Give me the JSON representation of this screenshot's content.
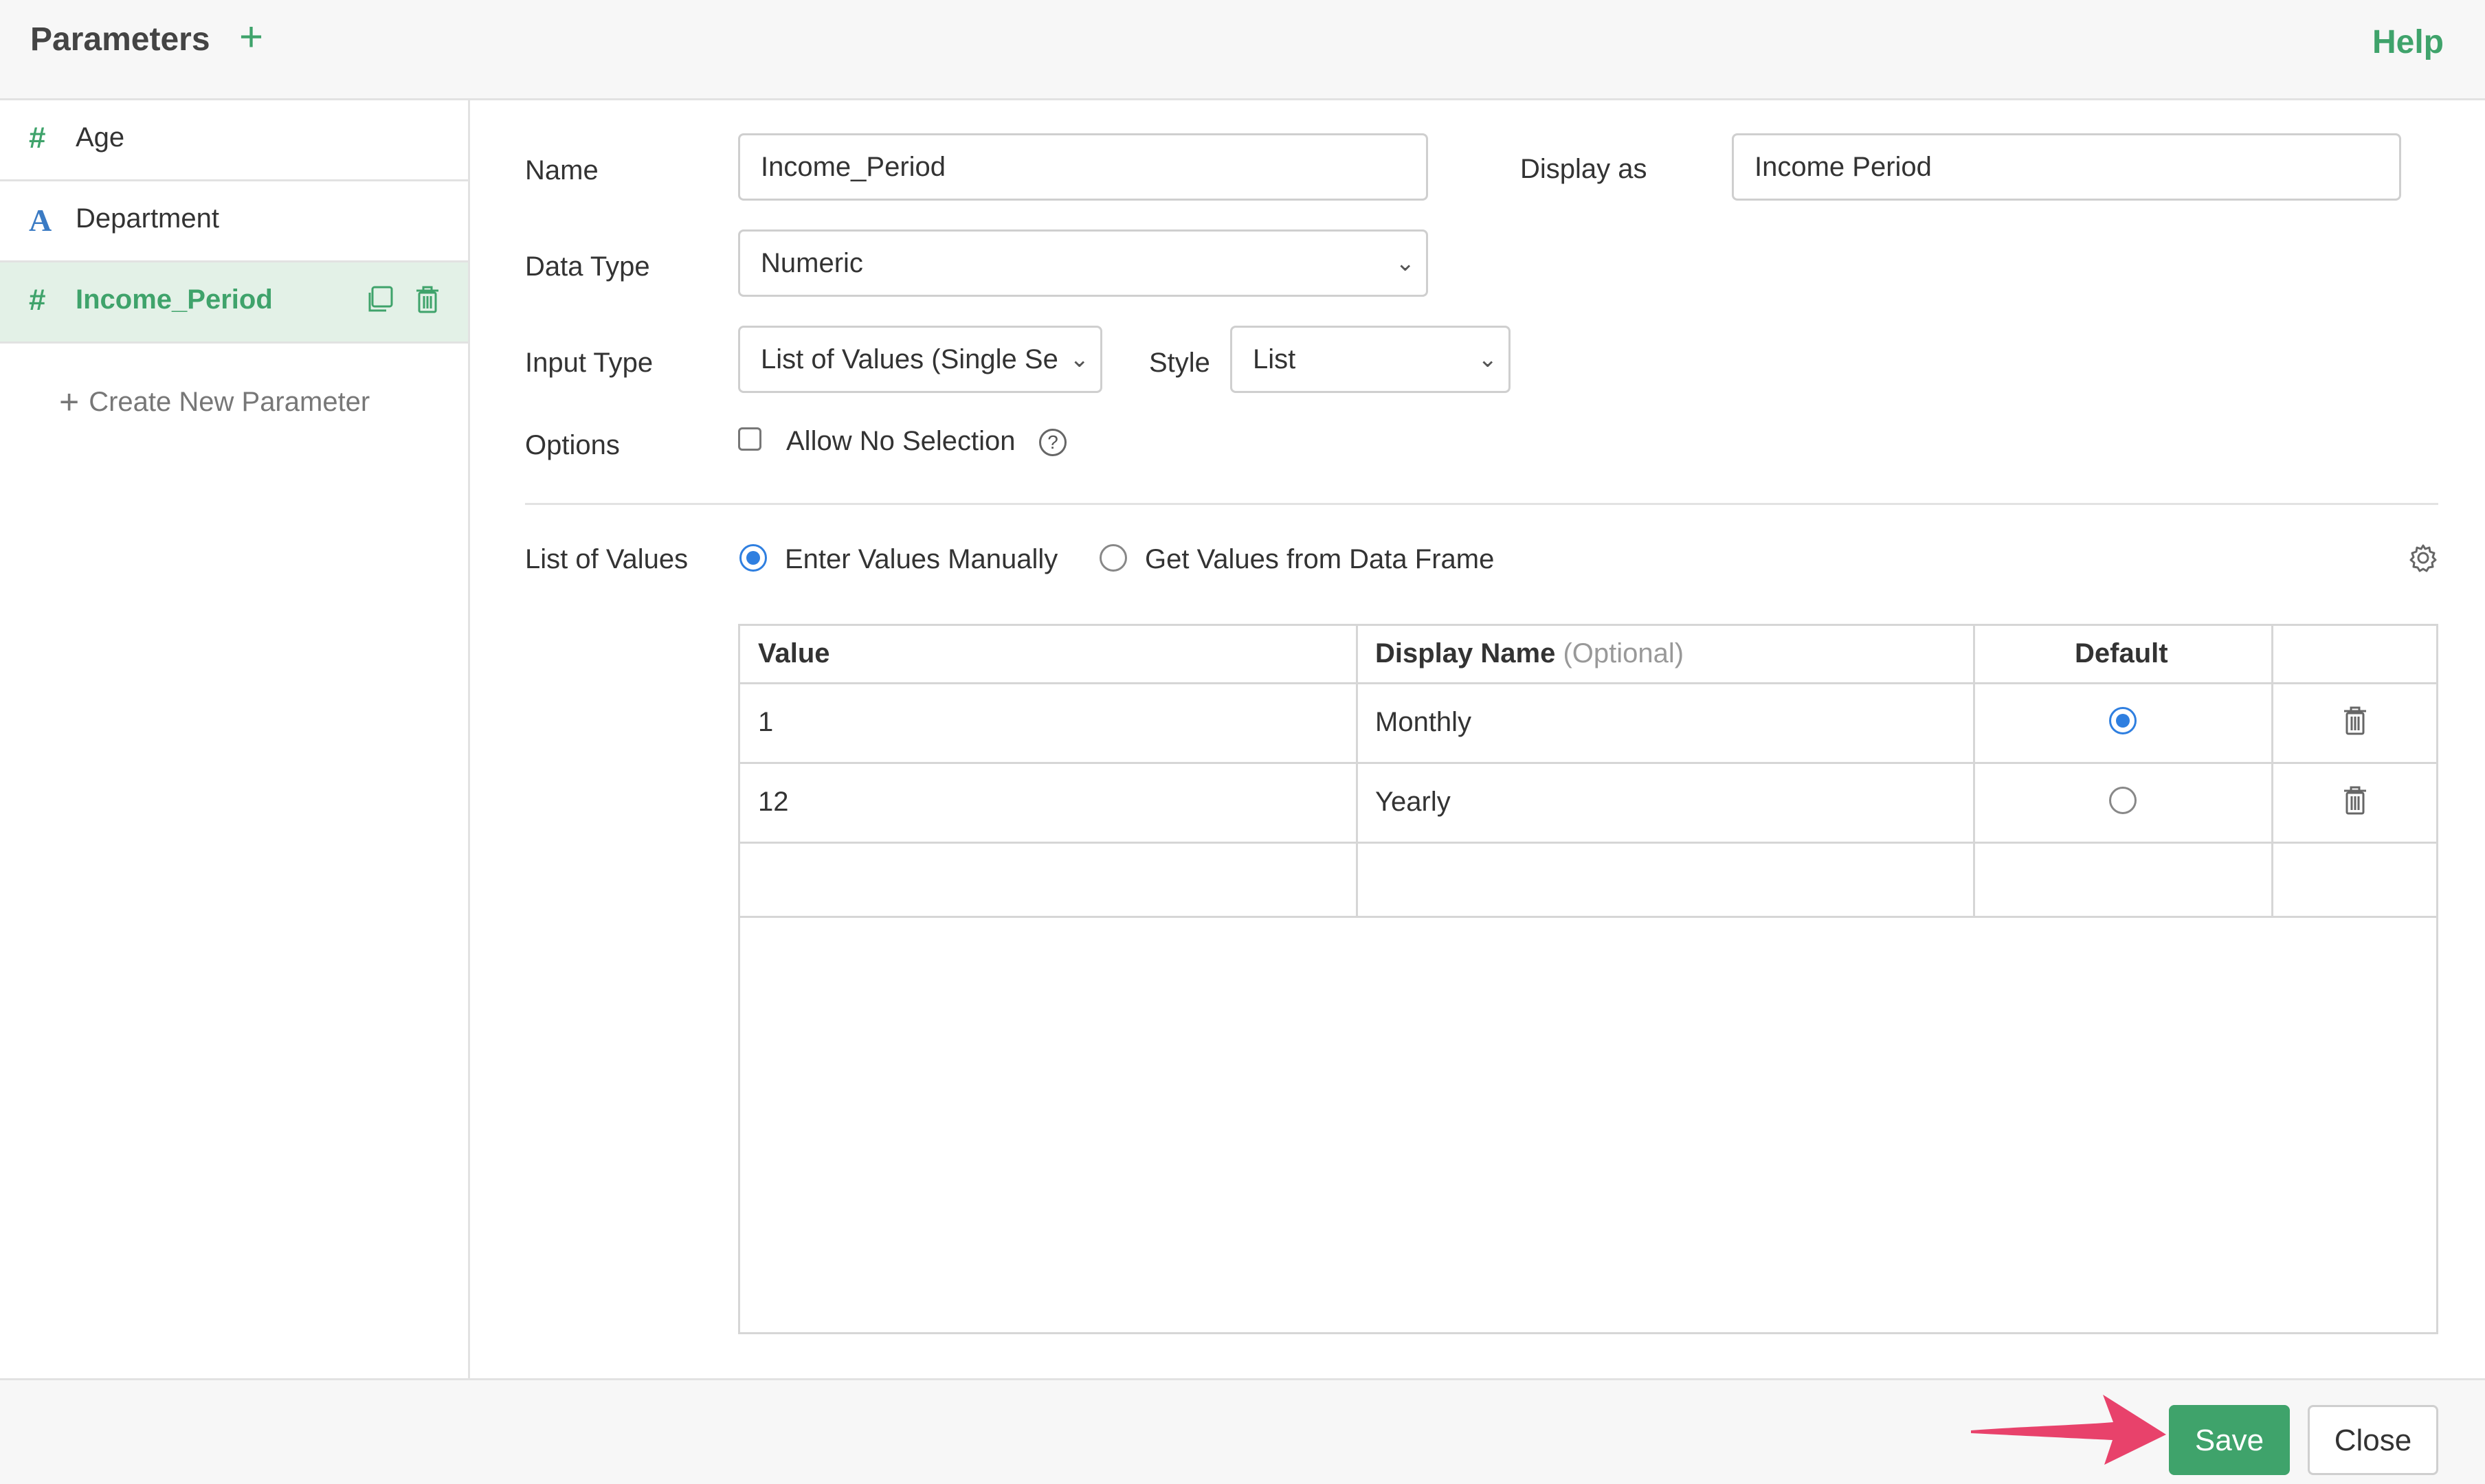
{
  "header": {
    "title": "Parameters",
    "add_icon": "plus-icon",
    "help_label": "Help"
  },
  "sidebar": {
    "items": [
      {
        "icon": "#",
        "icon_name": "numeric-type-icon",
        "label": "Age"
      },
      {
        "icon": "A",
        "icon_name": "string-type-icon",
        "label": "Department"
      },
      {
        "icon": "#",
        "icon_name": "numeric-type-icon",
        "label": "Income_Period",
        "active": true
      }
    ],
    "create_new_label": "Create New Parameter"
  },
  "form": {
    "name_label": "Name",
    "name_value": "Income_Period",
    "display_as_label": "Display as",
    "display_as_value": "Income Period",
    "data_type_label": "Data Type",
    "data_type_value": "Numeric",
    "input_type_label": "Input Type",
    "input_type_value": "List of Values (Single Se",
    "style_label": "Style",
    "style_value": "List",
    "options_label": "Options",
    "allow_no_selection_label": "Allow No Selection",
    "allow_no_selection_checked": false,
    "list_of_values_label": "List of Values",
    "radio_manual_label": "Enter Values Manually",
    "radio_dataframe_label": "Get Values from Data Frame",
    "selected_source": "manual"
  },
  "table": {
    "headers": {
      "value": "Value",
      "display_name": "Display Name",
      "display_name_hint": "(Optional)",
      "default": "Default"
    },
    "rows": [
      {
        "value": "1",
        "display_name": "Monthly",
        "default": true
      },
      {
        "value": "12",
        "display_name": "Yearly",
        "default": false
      }
    ]
  },
  "footer": {
    "save_label": "Save",
    "close_label": "Close"
  },
  "colors": {
    "accent_green": "#3fa36b",
    "radio_blue": "#2f7fe0",
    "annotation_arrow": "#e8426b"
  }
}
